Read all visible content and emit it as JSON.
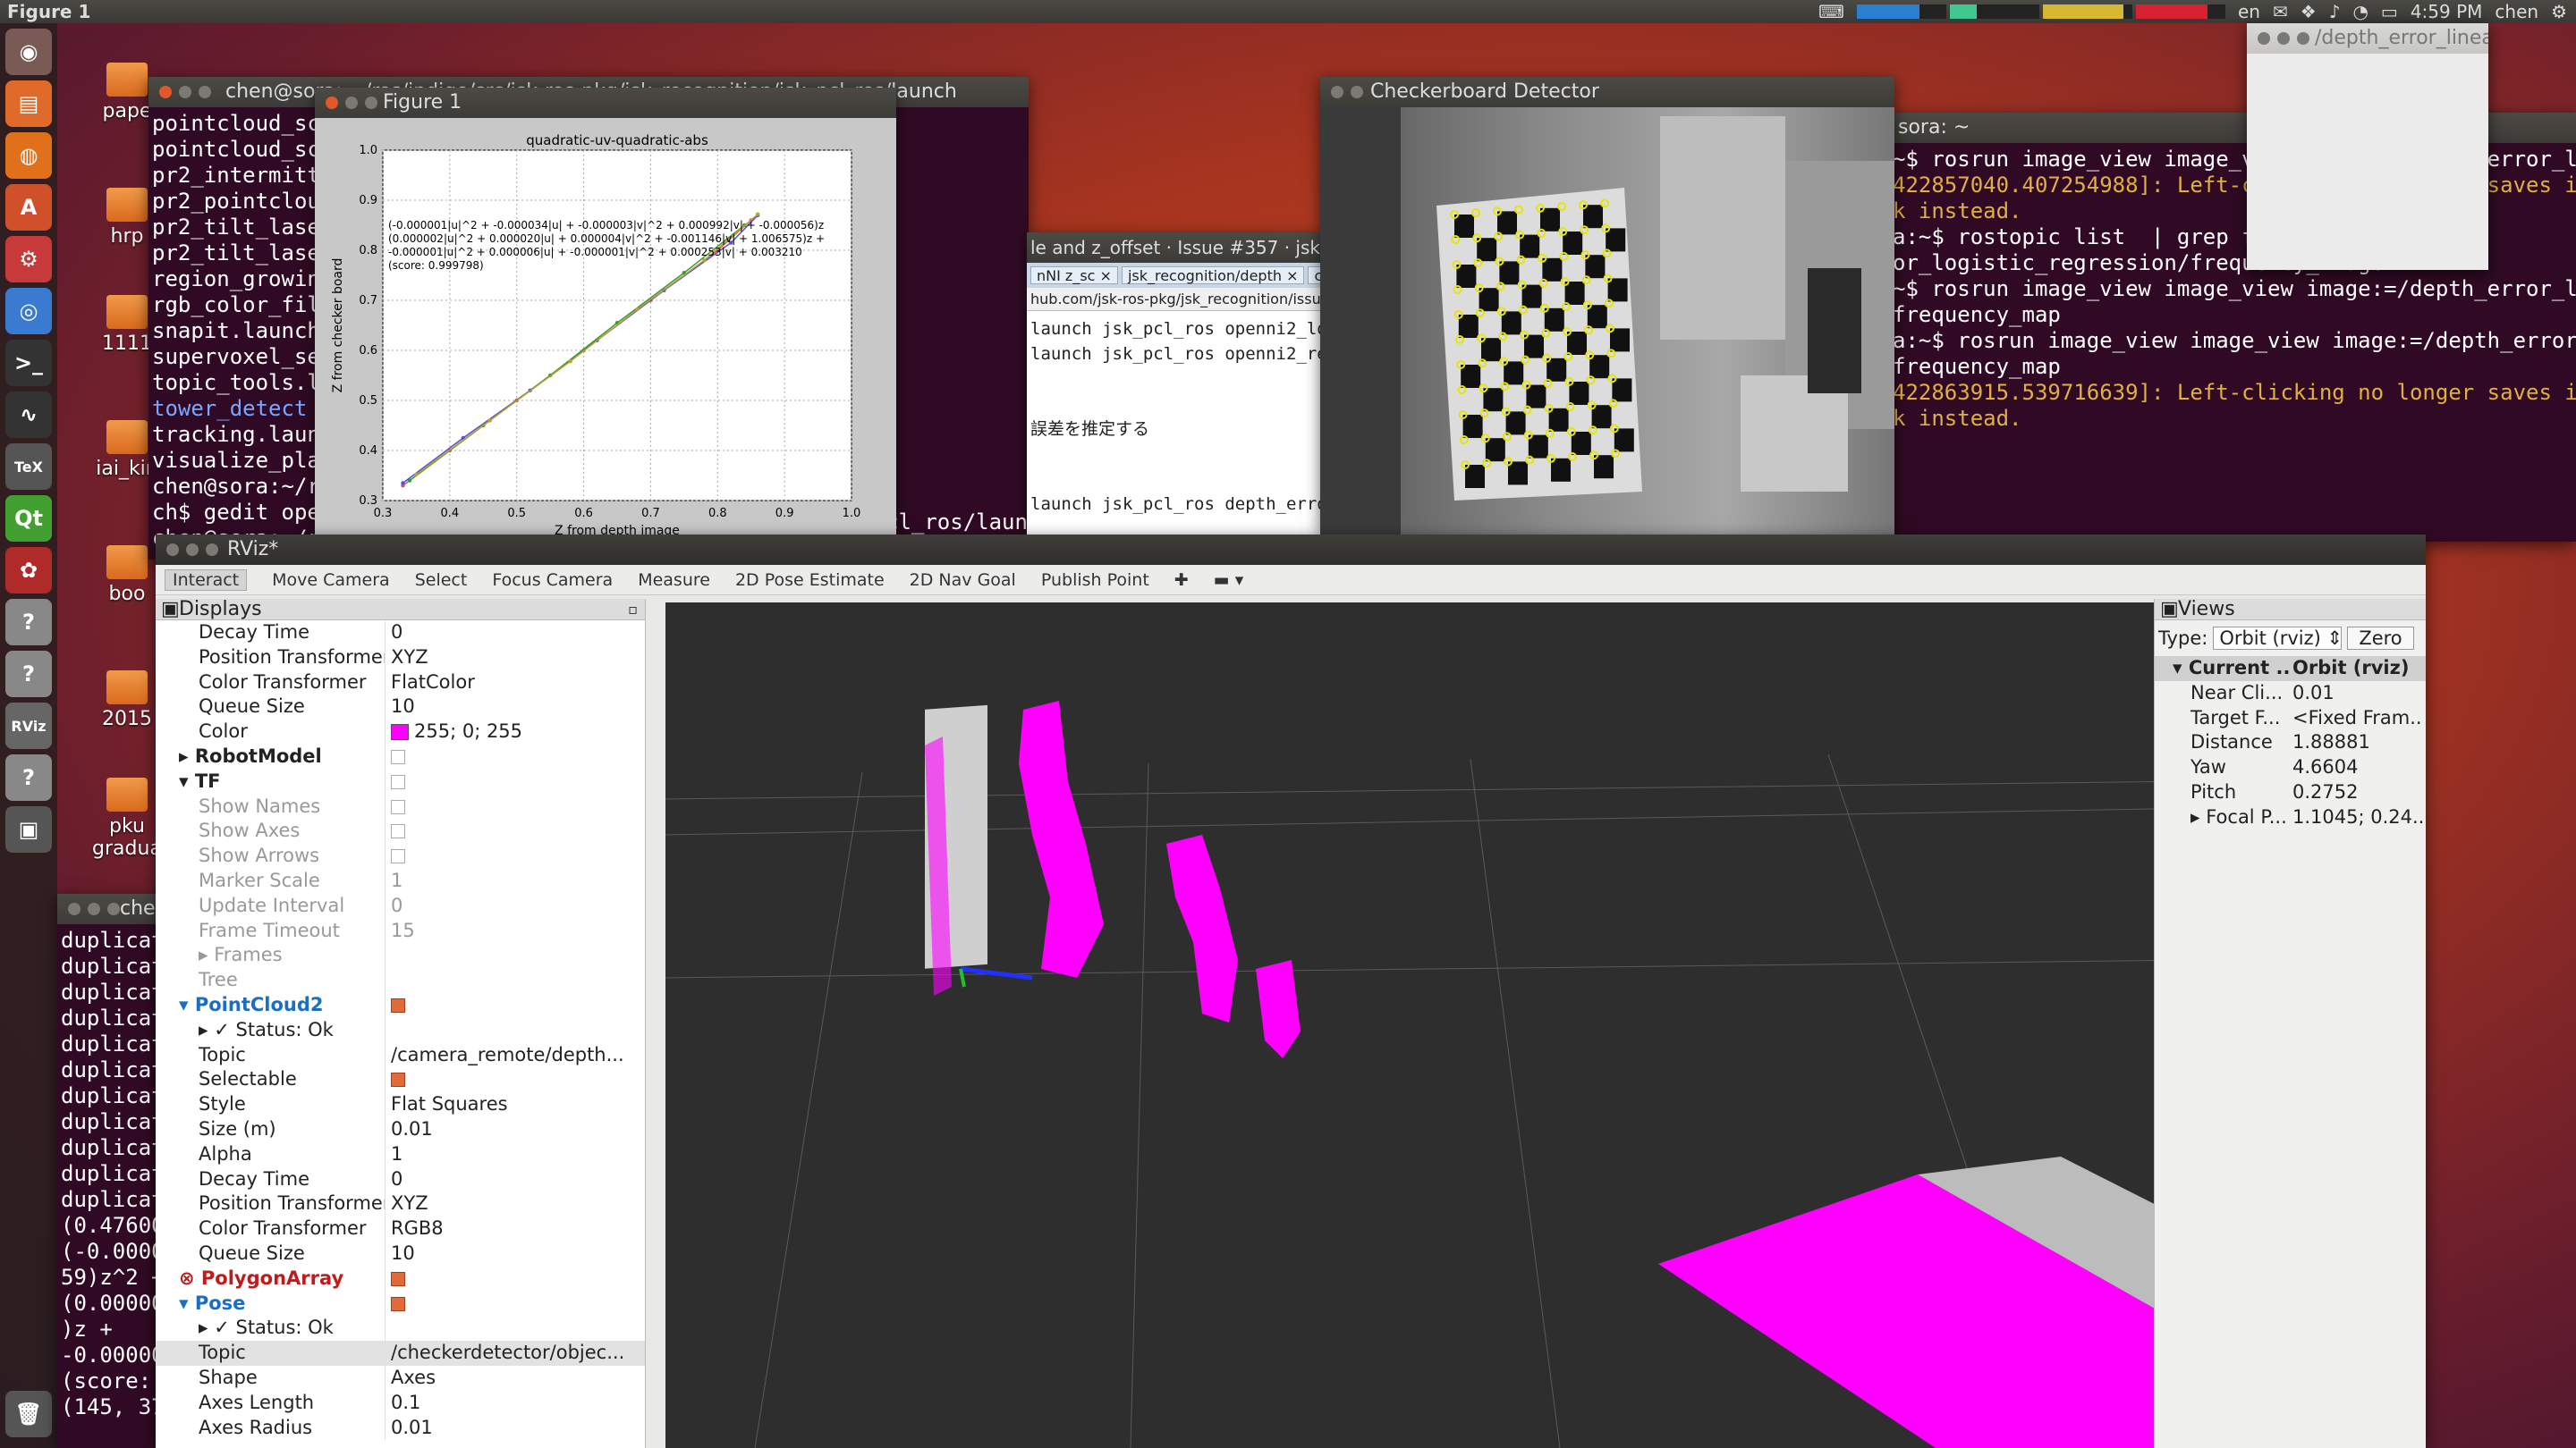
{
  "top_panel": {
    "app_title": "Figure 1",
    "lang": "en",
    "time": "4:59 PM",
    "user": "chen",
    "meters": [
      {
        "color": "#2a7fd0",
        "level": 0.7
      },
      {
        "color": "#40c890",
        "level": 0.3
      },
      {
        "color": "#d8b830",
        "level": 0.9
      },
      {
        "color": "#d82030",
        "level": 0.8
      }
    ]
  },
  "launcher": {
    "items": [
      {
        "name": "dash-icon",
        "glyph": "◉",
        "color": "#7a5a55"
      },
      {
        "name": "files-icon",
        "glyph": "▤",
        "color": "#e06a2a"
      },
      {
        "name": "firefox-icon",
        "glyph": "◍",
        "color": "#e0701a"
      },
      {
        "name": "software-center-icon",
        "glyph": "A",
        "color": "#d0502a"
      },
      {
        "name": "settings-icon",
        "glyph": "⚙",
        "color": "#c83a3a"
      },
      {
        "name": "chromium-icon",
        "glyph": "◎",
        "color": "#3a7ad0"
      },
      {
        "name": "terminal-icon",
        "glyph": ">_",
        "color": "#333333"
      },
      {
        "name": "system-monitor-icon",
        "glyph": "∿",
        "color": "#333333"
      },
      {
        "name": "texmaker-icon",
        "glyph": "TeX",
        "color": "#555555"
      },
      {
        "name": "qtcreator-icon",
        "glyph": "Qt",
        "color": "#41a030"
      },
      {
        "name": "gimp-icon",
        "glyph": "✿",
        "color": "#b02a2a"
      },
      {
        "name": "unknown-app-icon",
        "glyph": "?",
        "color": "#888888"
      },
      {
        "name": "unknown-app-icon",
        "glyph": "?",
        "color": "#888888"
      },
      {
        "name": "rviz-icon",
        "glyph": "RViz",
        "color": "#666666"
      },
      {
        "name": "unknown-app-icon",
        "glyph": "?",
        "color": "#888888"
      },
      {
        "name": "workspace-icon",
        "glyph": "▣",
        "color": "#555555"
      },
      {
        "name": "trash-icon",
        "glyph": "🗑",
        "color": "#555555"
      }
    ]
  },
  "desktop": {
    "icons": [
      "pape",
      "hrp",
      "1111",
      "iai_kin",
      "boo",
      "2015",
      "pku gradua"
    ]
  },
  "term1": {
    "title": "chen@sora: ~/ros/indigo/src/jsk-ros-pkg/jsk_recognition/jsk_pcl_ros/launch",
    "lines": [
      "pointcloud_sc",
      "pointcloud_sc",
      "pr2_intermitt",
      "pr2_pointclou",
      "pr2_tilt_lase",
      "pr2_tilt_lase",
      "region_growin",
      "rgb_color_fil",
      "snapit.launch",
      "supervoxel_se",
      "topic_tools.l",
      "tower_detect",
      "tracking.laun",
      "visualize_pla",
      "chen@sora:~/r",
      "ch$ gedit ope",
      "chen@sora:~/r"
    ],
    "highlight_index": 11,
    "right_lines": [
      "cl_ros/laun",
      "cl_ros/laun"
    ]
  },
  "term2": {
    "title": "chen@sora: ~",
    "lines": [
      "duplicat",
      "duplicat",
      "duplicat",
      "duplicat",
      "duplicat",
      "duplicat",
      "duplicat",
      "duplicat",
      "duplicat",
      "duplicat",
      "duplicat",
      "(0.47600",
      "(-0.0000",
      "59)z^2 +",
      "(0.00000",
      ")z +",
      "-0.00000",
      "(score:",
      "(145, 37"
    ]
  },
  "figure": {
    "title": "Figure 1",
    "toolbar": [
      "⌂",
      "◀",
      "▶",
      "✥",
      "⬚",
      "▦",
      "💾"
    ]
  },
  "chart_data": {
    "type": "scatter",
    "title": "quadratic-uv-quadratic-abs",
    "xlabel": "Z from depth image",
    "ylabel": "Z from checker board",
    "xlim": [
      0.3,
      1.0
    ],
    "ylim": [
      0.3,
      1.0
    ],
    "xticks": [
      "0.3",
      "0.4",
      "0.5",
      "0.6",
      "0.7",
      "0.8",
      "0.9",
      "1.0"
    ],
    "yticks": [
      "0.3",
      "0.4",
      "0.5",
      "0.6",
      "0.7",
      "0.8",
      "0.9",
      "1.0"
    ],
    "grid": true,
    "annotation": [
      "(-0.000001|u|^2 + -0.000034|u| + -0.000003|v|^2 + 0.000992|v| + -0.000056)z",
      "(0.000002|u|^2 + 0.000020|u| + 0.000004|v|^2 + -0.001146|v| + 1.006575)z +",
      "-0.000001|u|^2 + 0.000006|u| + -0.000001|v|^2 + 0.000253|v| + 0.003210",
      "(score: 0.999798)"
    ],
    "series": [
      {
        "color": "#e05050",
        "x": [
          0.33,
          0.4,
          0.5,
          0.6,
          0.7,
          0.8,
          0.85
        ],
        "y": [
          0.33,
          0.4,
          0.5,
          0.6,
          0.7,
          0.8,
          0.86
        ]
      },
      {
        "color": "#5050e0",
        "x": [
          0.33,
          0.42,
          0.52,
          0.62,
          0.72,
          0.82,
          0.86
        ],
        "y": [
          0.335,
          0.425,
          0.52,
          0.62,
          0.72,
          0.815,
          0.87
        ]
      },
      {
        "color": "#30a030",
        "x": [
          0.34,
          0.45,
          0.55,
          0.65,
          0.75,
          0.84
        ],
        "y": [
          0.34,
          0.45,
          0.55,
          0.655,
          0.755,
          0.85
        ]
      },
      {
        "color": "#c0a030",
        "x": [
          0.35,
          0.46,
          0.58,
          0.68,
          0.78,
          0.86
        ],
        "y": [
          0.352,
          0.46,
          0.578,
          0.682,
          0.78,
          0.872
        ]
      }
    ]
  },
  "browser": {
    "title": "le and z_offset · Issue #357 · jsk-ros-pkg/jsk_recognition",
    "tabs": [
      "nNI z_sc ×",
      "jsk_recognition/depth ×",
      "cam"
    ],
    "url": "hub.com/jsk-ros-pkg/jsk_recognition/issues/3",
    "lines": [
      "launch jsk_pcl_ros openni2_loc",
      "launch jsk_pcl_ros openni2_rem",
      "",
      "",
      "誤差を推定する",
      "",
      "",
      "launch jsk_pcl_ros depth_error"
    ]
  },
  "checker": {
    "title": "Checkerboard Detector"
  },
  "term3": {
    "title": "sora: ~",
    "lines": [
      {
        "t": "~$ rosrun image_view image_view image:=/depth_error_lin",
        "c": ""
      },
      {
        "t": "422857040.407254988]: Left-clicking no longer saves ima",
        "c": "warn"
      },
      {
        "t": "k instead.",
        "c": "warn"
      },
      {
        "t": "a:~$ rostopic list  | grep fre",
        "c": ""
      },
      {
        "t": "or_logistic_regression/frequency_image",
        "c": ""
      },
      {
        "t": "~$ rosrun image_view image_view image:=/depth_error_lin",
        "c": ""
      },
      {
        "t": "frequency_map",
        "c": ""
      },
      {
        "t": "a:~$ rosrun image_view image_view image:=/depth_error_l",
        "c": ""
      },
      {
        "t": "frequency_map",
        "c": ""
      },
      {
        "t": "422863915.539716639]: Left-clicking no longer saves ima",
        "c": "warn"
      },
      {
        "t": "k instead.",
        "c": "warn"
      }
    ]
  },
  "depth_error_window": {
    "title": "/depth_error_linear_"
  },
  "rviz": {
    "title": "RViz*",
    "toolbar": [
      "Interact",
      "Move Camera",
      "Select",
      "Focus Camera",
      "Measure",
      "2D Pose Estimate",
      "2D Nav Goal",
      "Publish Point",
      "✚",
      "▬ ▾"
    ],
    "displays_title": "Displays",
    "rows": [
      {
        "k": "Decay Time",
        "v": "0"
      },
      {
        "k": "Position Transformer",
        "v": "XYZ"
      },
      {
        "k": "Color Transformer",
        "v": "FlatColor"
      },
      {
        "k": "Queue Size",
        "v": "10"
      },
      {
        "k": "Color",
        "v": "255; 0; 255",
        "swatch": true
      },
      {
        "k": "▸ RobotModel",
        "v": "",
        "level": 0,
        "chk": "off"
      },
      {
        "k": "▾ TF",
        "v": "",
        "level": 0,
        "chk": "off"
      },
      {
        "k": "Show Names",
        "v": "",
        "dis": true,
        "chk": "off"
      },
      {
        "k": "Show Axes",
        "v": "",
        "dis": true,
        "chk": "off"
      },
      {
        "k": "Show Arrows",
        "v": "",
        "dis": true,
        "chk": "off"
      },
      {
        "k": "Marker Scale",
        "v": "1",
        "dis": true
      },
      {
        "k": "Update Interval",
        "v": "0",
        "dis": true
      },
      {
        "k": "Frame Timeout",
        "v": "15",
        "dis": true
      },
      {
        "k": "▸ Frames",
        "v": "",
        "dis": true
      },
      {
        "k": "Tree",
        "v": "",
        "dis": true
      },
      {
        "k": "▾ PointCloud2",
        "v": "",
        "level": 0,
        "cls": "blue",
        "chk": "on"
      },
      {
        "k": "▸ ✓ Status: Ok",
        "v": ""
      },
      {
        "k": "Topic",
        "v": "/camera_remote/depth..."
      },
      {
        "k": "Selectable",
        "v": "",
        "chk": "on"
      },
      {
        "k": "Style",
        "v": "Flat Squares"
      },
      {
        "k": "Size (m)",
        "v": "0.01"
      },
      {
        "k": "Alpha",
        "v": "1"
      },
      {
        "k": "Decay Time",
        "v": "0"
      },
      {
        "k": "Position Transformer",
        "v": "XYZ"
      },
      {
        "k": "Color Transformer",
        "v": "RGB8"
      },
      {
        "k": "Queue Size",
        "v": "10"
      },
      {
        "k": "⊗ PolygonArray",
        "v": "",
        "level": 0,
        "cls": "red",
        "chk": "on"
      },
      {
        "k": "▾ Pose",
        "v": "",
        "level": 0,
        "cls": "blue",
        "chk": "on"
      },
      {
        "k": "▸ ✓ Status: Ok",
        "v": ""
      },
      {
        "k": "Topic",
        "v": "/checkerdetector/objec...",
        "sel": true
      },
      {
        "k": "Shape",
        "v": "Axes"
      },
      {
        "k": "Axes Length",
        "v": "0.1"
      },
      {
        "k": "Axes Radius",
        "v": "0.01"
      }
    ],
    "views": {
      "title": "Views",
      "type_label": "Type:",
      "type_value": "Orbit (rviz)",
      "zero_label": "Zero",
      "header": {
        "k": "Current ...",
        "v": "Orbit (rviz)"
      },
      "rows": [
        {
          "k": "Near Cli...",
          "v": "0.01"
        },
        {
          "k": "Target F...",
          "v": "<Fixed Fram..."
        },
        {
          "k": "Distance",
          "v": "1.88881"
        },
        {
          "k": "Yaw",
          "v": "4.6604"
        },
        {
          "k": "Pitch",
          "v": "0.2752"
        },
        {
          "k": "▸ Focal P...",
          "v": "1.1045; 0.24..."
        }
      ]
    }
  }
}
